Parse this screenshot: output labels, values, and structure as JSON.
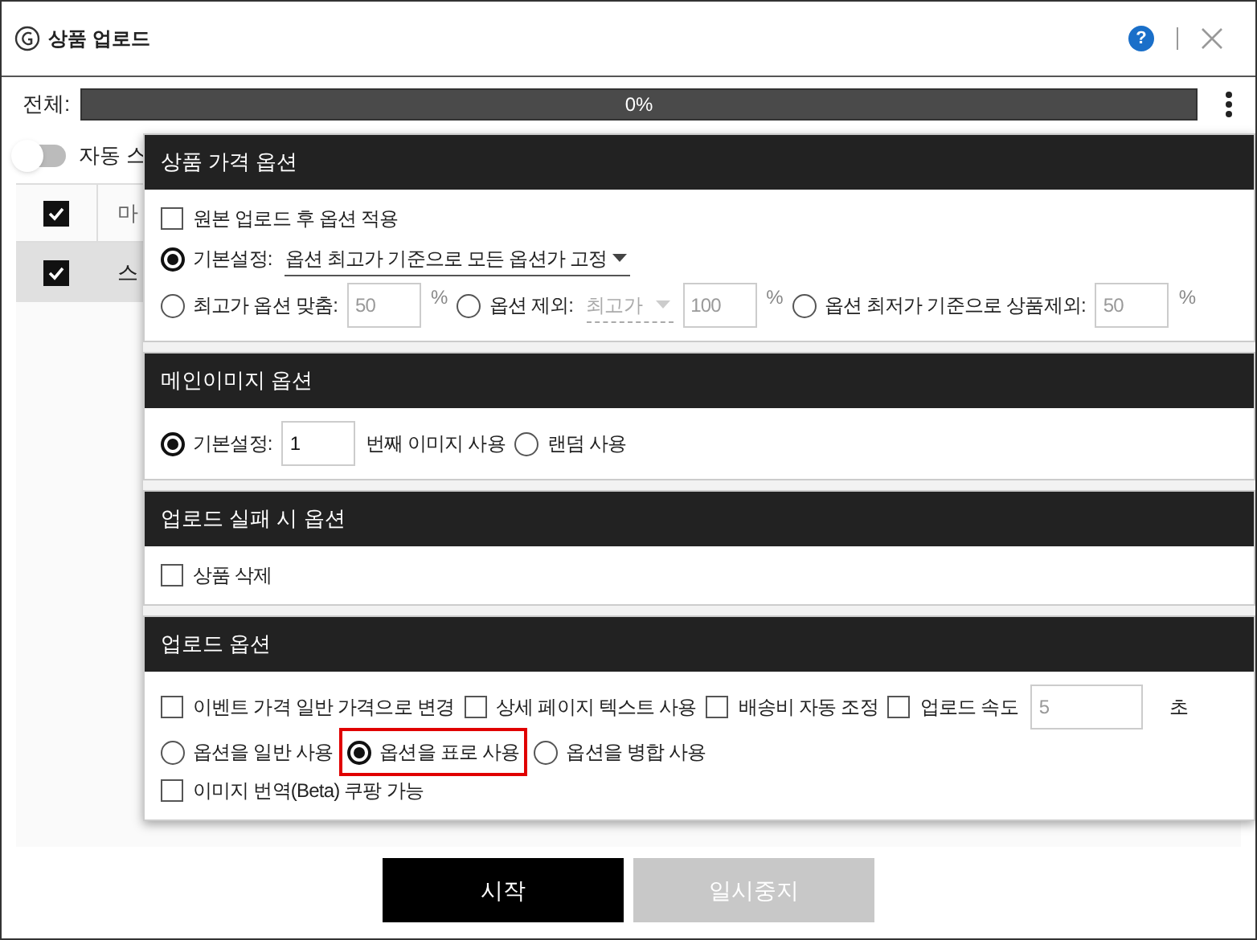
{
  "window": {
    "title": "상품 업로드",
    "help": "?"
  },
  "progress": {
    "label": "전체:",
    "text": "0%",
    "level": 0
  },
  "auto_toggle": {
    "label": "자동 스",
    "on": false
  },
  "table": {
    "header": {
      "checked": true,
      "text": "마"
    },
    "rows": [
      {
        "checked": true,
        "text": "스",
        "selected": true
      }
    ]
  },
  "sections": [
    {
      "title": "상품 가격 옵션",
      "rows": [
        {
          "controls": [
            {
              "kind": "checkbox",
              "label": "원본 업로드 후 옵션 적용",
              "checked": false
            }
          ]
        },
        {
          "controls": [
            {
              "kind": "radio",
              "label": "기본설정:",
              "selected": true
            },
            {
              "kind": "select",
              "value": "옵션 최고가 기준으로 모든 옵션가 고정",
              "disabled": false
            }
          ]
        },
        {
          "controls": [
            {
              "kind": "radio",
              "label": "최고가 옵션 맞춤:",
              "selected": false
            },
            {
              "kind": "input",
              "value": "50",
              "disabled": true
            },
            {
              "kind": "unit",
              "text": "%"
            },
            {
              "kind": "radio",
              "label": "옵션 제외:",
              "selected": false
            },
            {
              "kind": "select",
              "value": "최고가",
              "disabled": true
            },
            {
              "kind": "input",
              "value": "100",
              "disabled": true
            },
            {
              "kind": "unit",
              "text": "%"
            },
            {
              "kind": "radio",
              "label": "옵션 최저가 기준으로 상품제외:",
              "selected": false
            },
            {
              "kind": "input",
              "value": "50",
              "disabled": true
            },
            {
              "kind": "unit",
              "text": "%"
            }
          ]
        }
      ]
    },
    {
      "title": "메인이미지 옵션",
      "rows": [
        {
          "controls": [
            {
              "kind": "radio",
              "label": "기본설정:",
              "selected": true
            },
            {
              "kind": "input",
              "value": "1",
              "disabled": false
            },
            {
              "kind": "unit",
              "text": "번째 이미지 사용"
            },
            {
              "kind": "radio",
              "label": "랜덤 사용",
              "selected": false
            }
          ]
        }
      ]
    },
    {
      "title": "업로드 실패 시 옵션",
      "rows": [
        {
          "controls": [
            {
              "kind": "checkbox",
              "label": "상품 삭제",
              "checked": false
            }
          ]
        }
      ]
    },
    {
      "title": "업로드 옵션",
      "rows": [
        {
          "controls": [
            {
              "kind": "checkbox",
              "label": "이벤트 가격 일반 가격으로 변경",
              "checked": false
            },
            {
              "kind": "checkbox",
              "label": "상세 페이지 텍스트 사용",
              "checked": false
            },
            {
              "kind": "checkbox",
              "label": "배송비 자동 조정",
              "checked": false
            },
            {
              "kind": "checkbox",
              "label": "업로드 속도",
              "checked": false
            },
            {
              "kind": "long_input",
              "value": "5",
              "disabled": true
            },
            {
              "kind": "unit",
              "text": "초"
            }
          ]
        },
        {
          "controls": [
            {
              "kind": "radio",
              "label": "옵션을 일반 사용",
              "selected": false
            },
            {
              "kind": "radio",
              "label": "옵션을 표로 사용",
              "selected": true,
              "highlighted": true
            },
            {
              "kind": "radio",
              "label": "옵션을 병합 사용",
              "selected": false
            }
          ]
        },
        {
          "controls": [
            {
              "kind": "checkbox",
              "label": "이미지 번역(Beta) 쿠팡 가능",
              "checked": false
            }
          ]
        }
      ]
    }
  ],
  "buttons": [
    {
      "label": "시작",
      "disabled": false
    },
    {
      "label": "일시중지",
      "disabled": true
    }
  ]
}
